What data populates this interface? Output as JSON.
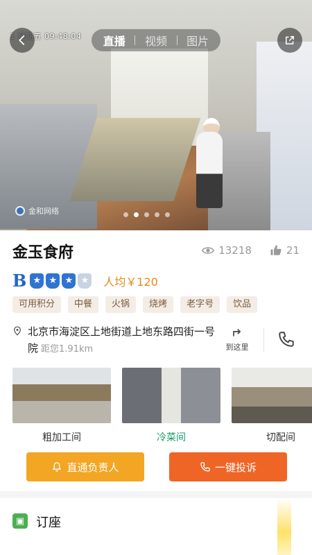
{
  "hero": {
    "timestamp": "1 星期五 09:48:04",
    "watermark": "金和网络",
    "media_tabs": [
      "直播",
      "视频",
      "图片"
    ],
    "active_tab_index": 0,
    "carousel_dot_count": 5,
    "carousel_active_index": 1
  },
  "restaurant": {
    "name": "金玉食府",
    "views": "13218",
    "likes": "21",
    "rating_letter": "B",
    "rating_stars_filled": 3,
    "rating_stars_total": 4,
    "avg_price": "人均￥120",
    "tags": [
      "可用积分",
      "中餐",
      "火锅",
      "烧烤",
      "老字号",
      "饮品"
    ],
    "address": "北京市海淀区上地街道上地东路四街一号院",
    "distance": "距您1.91km",
    "navigate_label": "到这里"
  },
  "rooms": [
    {
      "label": "粗加工间",
      "active": false
    },
    {
      "label": "冷菜间",
      "active": true
    },
    {
      "label": "切配间",
      "active": false
    }
  ],
  "actions": {
    "contact_label": "直通负责人",
    "complain_label": "一键投诉"
  },
  "booking": {
    "label": "订座"
  },
  "colors": {
    "brand_blue": "#2f74d0",
    "price_orange": "#e48a1c",
    "active_green": "#1a9a6a",
    "contact_yellow": "#f2a623",
    "complain_orange": "#ee6526"
  }
}
